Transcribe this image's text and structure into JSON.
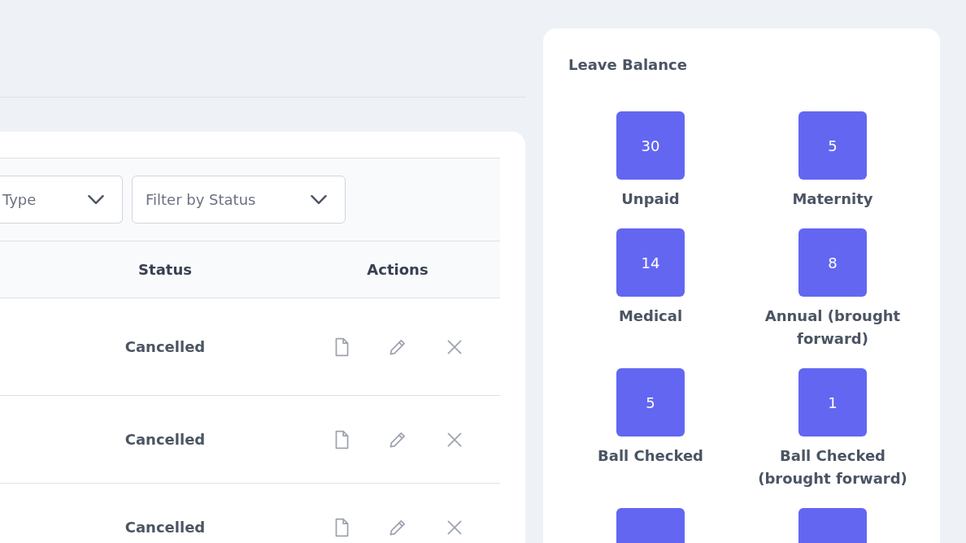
{
  "filters": [
    {
      "placeholder": "Type"
    },
    {
      "placeholder": "Filter by Status"
    }
  ],
  "table": {
    "columns": [
      "Status",
      "Actions"
    ],
    "rows": [
      {
        "status": "Cancelled"
      },
      {
        "status": "Cancelled"
      },
      {
        "status": "Cancelled"
      }
    ]
  },
  "leave_balance": {
    "title": "Leave Balance",
    "items": [
      {
        "value": "30",
        "label": "Unpaid"
      },
      {
        "value": "5",
        "label": "Maternity"
      },
      {
        "value": "14",
        "label": "Medical"
      },
      {
        "value": "8",
        "label": "Annual (brought forward)"
      },
      {
        "value": "5",
        "label": "Ball Checked"
      },
      {
        "value": "1",
        "label": "Ball Checked (brought forward)"
      },
      {
        "kind": "tile"
      },
      {
        "kind": "tile"
      }
    ]
  }
}
